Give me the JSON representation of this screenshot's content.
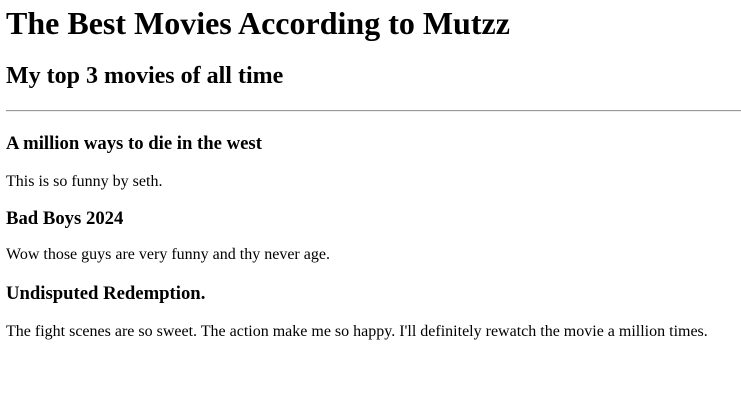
{
  "page": {
    "title": "The Best Movies According to Mutzz",
    "subtitle": "My top 3 movies of all time"
  },
  "movies": [
    {
      "title": "A million ways to die in the west",
      "review": "This is so funny by seth."
    },
    {
      "title": "Bad Boys 2024",
      "review": "Wow those guys are very funny and thy never age."
    },
    {
      "title": "Undisputed Redemption.",
      "review": "The fight scenes are so sweet. The action make me so happy. I'll definitely rewatch the movie a million times."
    }
  ]
}
